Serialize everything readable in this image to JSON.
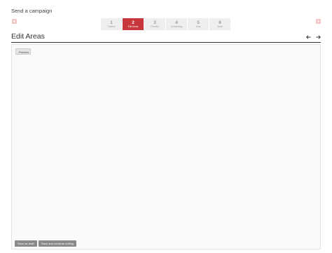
{
  "header": {
    "title": "Send a campaign"
  },
  "steps": [
    {
      "num": "1",
      "label": "Content"
    },
    {
      "num": "2",
      "label": "Edit Areas"
    },
    {
      "num": "3",
      "label": "Preview"
    },
    {
      "num": "4",
      "label": "Scheduling"
    },
    {
      "num": "5",
      "label": "Lists"
    },
    {
      "num": "6",
      "label": "Send"
    }
  ],
  "active_step": 2,
  "section": {
    "title": "Edit Areas"
  },
  "buttons": {
    "preview": "Preview",
    "save_draft": "Save as draft",
    "save_continue": "Save and continue editing"
  },
  "icons": {
    "top_left": "arrow-left-icon",
    "top_right": "arrow-right-icon",
    "prev": "arrow-left-icon",
    "next": "arrow-right-icon"
  },
  "colors": {
    "accent": "#c8373b",
    "step_bg": "#eeeeee",
    "button_gray": "#8a8a8a",
    "nav_box": "#f3c6c6"
  }
}
